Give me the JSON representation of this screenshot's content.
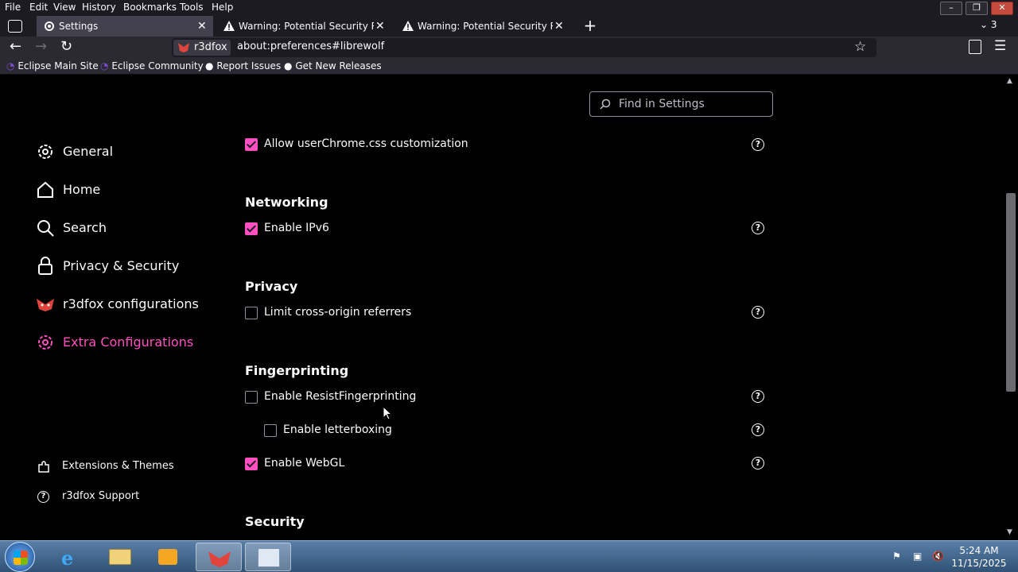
{
  "menu": {
    "file": "File",
    "edit": "Edit",
    "view": "View",
    "history": "History",
    "bookmarks": "Bookmarks",
    "tools": "Tools",
    "help": "Help"
  },
  "tabs": [
    {
      "title": "Settings",
      "active": true
    },
    {
      "title": "Warning: Potential Security Risk",
      "active": false
    },
    {
      "title": "Warning: Potential Security Risk",
      "active": false
    }
  ],
  "tab_count": "3",
  "urlbar": {
    "identity": "r3dfox",
    "url": "about:preferences#librewolf"
  },
  "bookmarks": [
    "Eclipse Main Site",
    "Eclipse Community",
    "Report Issues",
    "Get New Releases"
  ],
  "search": {
    "placeholder": "Find in Settings"
  },
  "sidebar": {
    "items": [
      {
        "label": "General",
        "icon": "gear-icon"
      },
      {
        "label": "Home",
        "icon": "home-icon"
      },
      {
        "label": "Search",
        "icon": "search-icon"
      },
      {
        "label": "Privacy & Security",
        "icon": "lock-icon"
      },
      {
        "label": "r3dfox configurations",
        "icon": "r3dfox-icon"
      },
      {
        "label": "Extra Configurations",
        "icon": "gear-icon",
        "active": true
      }
    ],
    "footer": [
      {
        "label": "Extensions & Themes",
        "icon": "puzzle-icon"
      },
      {
        "label": "r3dfox Support",
        "icon": "help-icon"
      }
    ]
  },
  "main": {
    "top_option": {
      "label": "Allow userChrome.css customization",
      "checked": true
    },
    "sections": [
      {
        "heading": "Networking",
        "options": [
          {
            "label": "Enable IPv6",
            "checked": true
          }
        ]
      },
      {
        "heading": "Privacy",
        "options": [
          {
            "label": "Limit cross-origin referrers",
            "checked": false
          }
        ]
      },
      {
        "heading": "Fingerprinting",
        "options": [
          {
            "label": "Enable ResistFingerprinting",
            "checked": false
          },
          {
            "label": "Enable letterboxing",
            "checked": false
          },
          {
            "label": "Enable WebGL",
            "checked": true
          }
        ]
      },
      {
        "heading": "Security",
        "options": []
      }
    ],
    "help_glyph": "?"
  },
  "clock": {
    "time": "5:24 AM",
    "date": "11/15/2025"
  },
  "colors": {
    "accent": "#ff4fc1",
    "background": "#000000",
    "chrome": "#1c1b22"
  }
}
